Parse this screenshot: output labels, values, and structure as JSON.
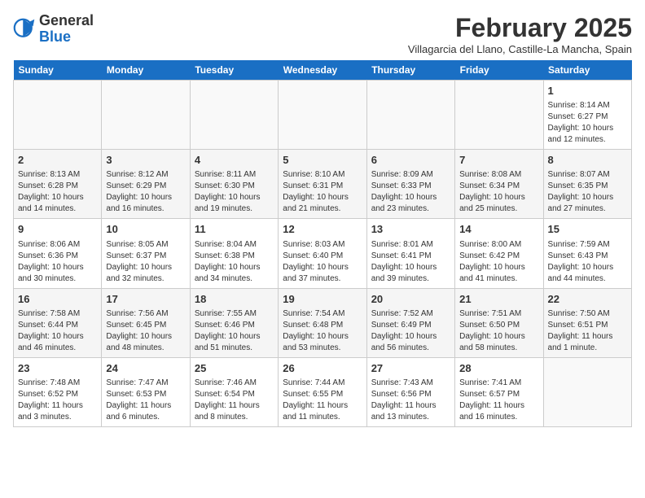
{
  "logo": {
    "general": "General",
    "blue": "Blue"
  },
  "header": {
    "title": "February 2025",
    "subtitle": "Villagarcia del Llano, Castille-La Mancha, Spain"
  },
  "weekdays": [
    "Sunday",
    "Monday",
    "Tuesday",
    "Wednesday",
    "Thursday",
    "Friday",
    "Saturday"
  ],
  "weeks": [
    [
      {
        "day": "",
        "info": ""
      },
      {
        "day": "",
        "info": ""
      },
      {
        "day": "",
        "info": ""
      },
      {
        "day": "",
        "info": ""
      },
      {
        "day": "",
        "info": ""
      },
      {
        "day": "",
        "info": ""
      },
      {
        "day": "1",
        "info": "Sunrise: 8:14 AM\nSunset: 6:27 PM\nDaylight: 10 hours and 12 minutes."
      }
    ],
    [
      {
        "day": "2",
        "info": "Sunrise: 8:13 AM\nSunset: 6:28 PM\nDaylight: 10 hours and 14 minutes."
      },
      {
        "day": "3",
        "info": "Sunrise: 8:12 AM\nSunset: 6:29 PM\nDaylight: 10 hours and 16 minutes."
      },
      {
        "day": "4",
        "info": "Sunrise: 8:11 AM\nSunset: 6:30 PM\nDaylight: 10 hours and 19 minutes."
      },
      {
        "day": "5",
        "info": "Sunrise: 8:10 AM\nSunset: 6:31 PM\nDaylight: 10 hours and 21 minutes."
      },
      {
        "day": "6",
        "info": "Sunrise: 8:09 AM\nSunset: 6:33 PM\nDaylight: 10 hours and 23 minutes."
      },
      {
        "day": "7",
        "info": "Sunrise: 8:08 AM\nSunset: 6:34 PM\nDaylight: 10 hours and 25 minutes."
      },
      {
        "day": "8",
        "info": "Sunrise: 8:07 AM\nSunset: 6:35 PM\nDaylight: 10 hours and 27 minutes."
      }
    ],
    [
      {
        "day": "9",
        "info": "Sunrise: 8:06 AM\nSunset: 6:36 PM\nDaylight: 10 hours and 30 minutes."
      },
      {
        "day": "10",
        "info": "Sunrise: 8:05 AM\nSunset: 6:37 PM\nDaylight: 10 hours and 32 minutes."
      },
      {
        "day": "11",
        "info": "Sunrise: 8:04 AM\nSunset: 6:38 PM\nDaylight: 10 hours and 34 minutes."
      },
      {
        "day": "12",
        "info": "Sunrise: 8:03 AM\nSunset: 6:40 PM\nDaylight: 10 hours and 37 minutes."
      },
      {
        "day": "13",
        "info": "Sunrise: 8:01 AM\nSunset: 6:41 PM\nDaylight: 10 hours and 39 minutes."
      },
      {
        "day": "14",
        "info": "Sunrise: 8:00 AM\nSunset: 6:42 PM\nDaylight: 10 hours and 41 minutes."
      },
      {
        "day": "15",
        "info": "Sunrise: 7:59 AM\nSunset: 6:43 PM\nDaylight: 10 hours and 44 minutes."
      }
    ],
    [
      {
        "day": "16",
        "info": "Sunrise: 7:58 AM\nSunset: 6:44 PM\nDaylight: 10 hours and 46 minutes."
      },
      {
        "day": "17",
        "info": "Sunrise: 7:56 AM\nSunset: 6:45 PM\nDaylight: 10 hours and 48 minutes."
      },
      {
        "day": "18",
        "info": "Sunrise: 7:55 AM\nSunset: 6:46 PM\nDaylight: 10 hours and 51 minutes."
      },
      {
        "day": "19",
        "info": "Sunrise: 7:54 AM\nSunset: 6:48 PM\nDaylight: 10 hours and 53 minutes."
      },
      {
        "day": "20",
        "info": "Sunrise: 7:52 AM\nSunset: 6:49 PM\nDaylight: 10 hours and 56 minutes."
      },
      {
        "day": "21",
        "info": "Sunrise: 7:51 AM\nSunset: 6:50 PM\nDaylight: 10 hours and 58 minutes."
      },
      {
        "day": "22",
        "info": "Sunrise: 7:50 AM\nSunset: 6:51 PM\nDaylight: 11 hours and 1 minute."
      }
    ],
    [
      {
        "day": "23",
        "info": "Sunrise: 7:48 AM\nSunset: 6:52 PM\nDaylight: 11 hours and 3 minutes."
      },
      {
        "day": "24",
        "info": "Sunrise: 7:47 AM\nSunset: 6:53 PM\nDaylight: 11 hours and 6 minutes."
      },
      {
        "day": "25",
        "info": "Sunrise: 7:46 AM\nSunset: 6:54 PM\nDaylight: 11 hours and 8 minutes."
      },
      {
        "day": "26",
        "info": "Sunrise: 7:44 AM\nSunset: 6:55 PM\nDaylight: 11 hours and 11 minutes."
      },
      {
        "day": "27",
        "info": "Sunrise: 7:43 AM\nSunset: 6:56 PM\nDaylight: 11 hours and 13 minutes."
      },
      {
        "day": "28",
        "info": "Sunrise: 7:41 AM\nSunset: 6:57 PM\nDaylight: 11 hours and 16 minutes."
      },
      {
        "day": "",
        "info": ""
      }
    ]
  ]
}
